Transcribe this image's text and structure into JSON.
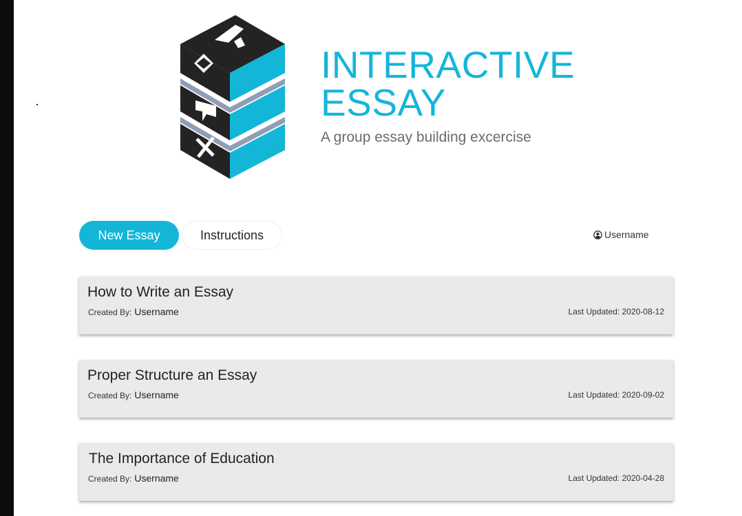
{
  "brand": {
    "title_line1": "INTERACTIVE",
    "title_line2": "ESSAY",
    "subtitle": "A group essay building excercise",
    "accent_color": "#14b6d8"
  },
  "toolbar": {
    "new_essay_label": "New Essay",
    "instructions_label": "Instructions"
  },
  "user": {
    "icon": "user-circle-icon",
    "name": "Username"
  },
  "essays": [
    {
      "title": "How to Write an Essay",
      "created_by_label": "Created By:",
      "created_by": "Username",
      "updated_label": "Last Updated:",
      "updated": "2020-08-12"
    },
    {
      "title": "Proper Structure an Essay",
      "created_by_label": "Created By:",
      "created_by": "Username",
      "updated_label": "Last Updated:",
      "updated": "2020-09-02"
    },
    {
      "title": "The Importance of Education",
      "created_by_label": "Created By:",
      "created_by": "Username",
      "updated_label": "Last Updated:",
      "updated": "2020-04-28"
    }
  ]
}
